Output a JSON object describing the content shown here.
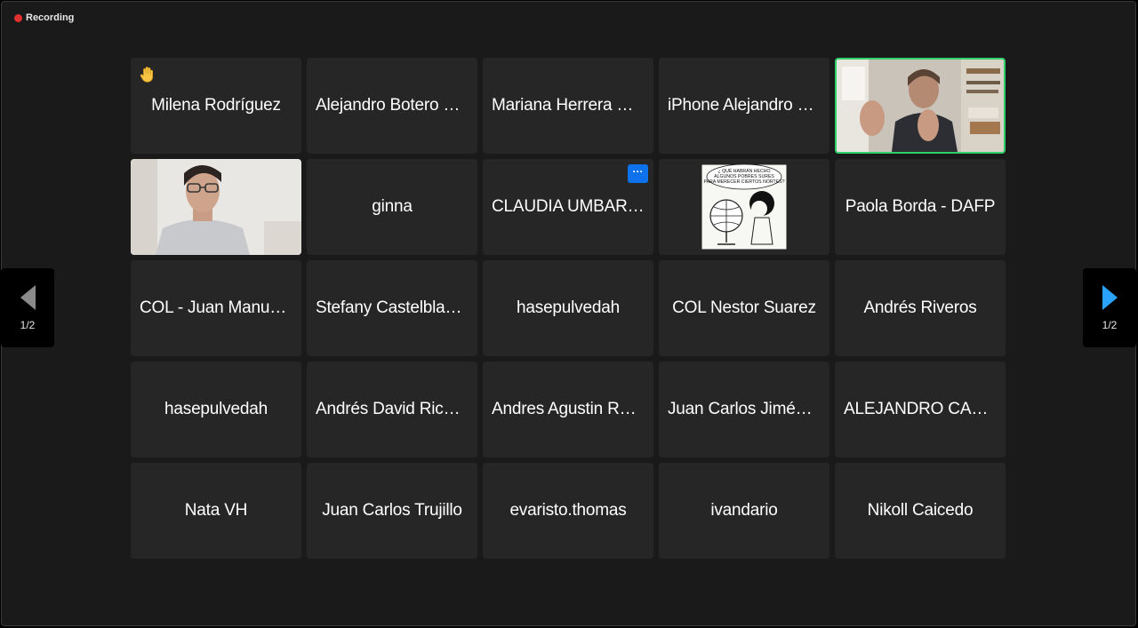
{
  "recording": {
    "label": "Recording",
    "dot_color": "#e0312f"
  },
  "navigation": {
    "prev_page_label": "1/2",
    "next_page_label": "1/2",
    "prev_arrow_color": "#8a8a8a",
    "next_arrow_color": "#2aa3ff"
  },
  "participants": [
    {
      "name": "Milena Rodríguez",
      "hand_raised": true
    },
    {
      "name": "Alejandro Botero Mejía"
    },
    {
      "name": "Mariana Herrera Ruiz"
    },
    {
      "name": "iPhone Alejandro Gómez"
    },
    {
      "name": "",
      "video": "man-gesturing",
      "active_speaker": true,
      "speaker_border_color": "#2fd06a"
    },
    {
      "name": "",
      "video": "man-with-glasses"
    },
    {
      "name": "ginna"
    },
    {
      "name": "CLAUDIA UMBARILA",
      "more_menu_icon": "more-dots-icon",
      "more_label": "···"
    },
    {
      "name": "",
      "video": "comic-mafalda-globe",
      "comic_text": [
        "¿ QUÉ HABRÁN HECHO",
        "ALGUNOS POBRES SURES",
        "PARA MERECER CIERTOS NORTES?"
      ]
    },
    {
      "name": "Paola Borda - DAFP"
    },
    {
      "name": "COL -  Juan Manuel Rojas"
    },
    {
      "name": "Stefany Castelblanco"
    },
    {
      "name": "hasepulvedah"
    },
    {
      "name": "COL Nestor Suarez"
    },
    {
      "name": "Andrés Riveros"
    },
    {
      "name": "hasepulvedah"
    },
    {
      "name": "Andrés David Ricardo"
    },
    {
      "name": "Andres Agustin Ramos"
    },
    {
      "name": "Juan Carlos Jiménez"
    },
    {
      "name": "ALEJANDRO CASTRO"
    },
    {
      "name": "Nata VH"
    },
    {
      "name": "Juan Carlos Trujillo"
    },
    {
      "name": "evaristo.thomas"
    },
    {
      "name": "ivandario"
    },
    {
      "name": "Nikoll Caicedo"
    }
  ]
}
